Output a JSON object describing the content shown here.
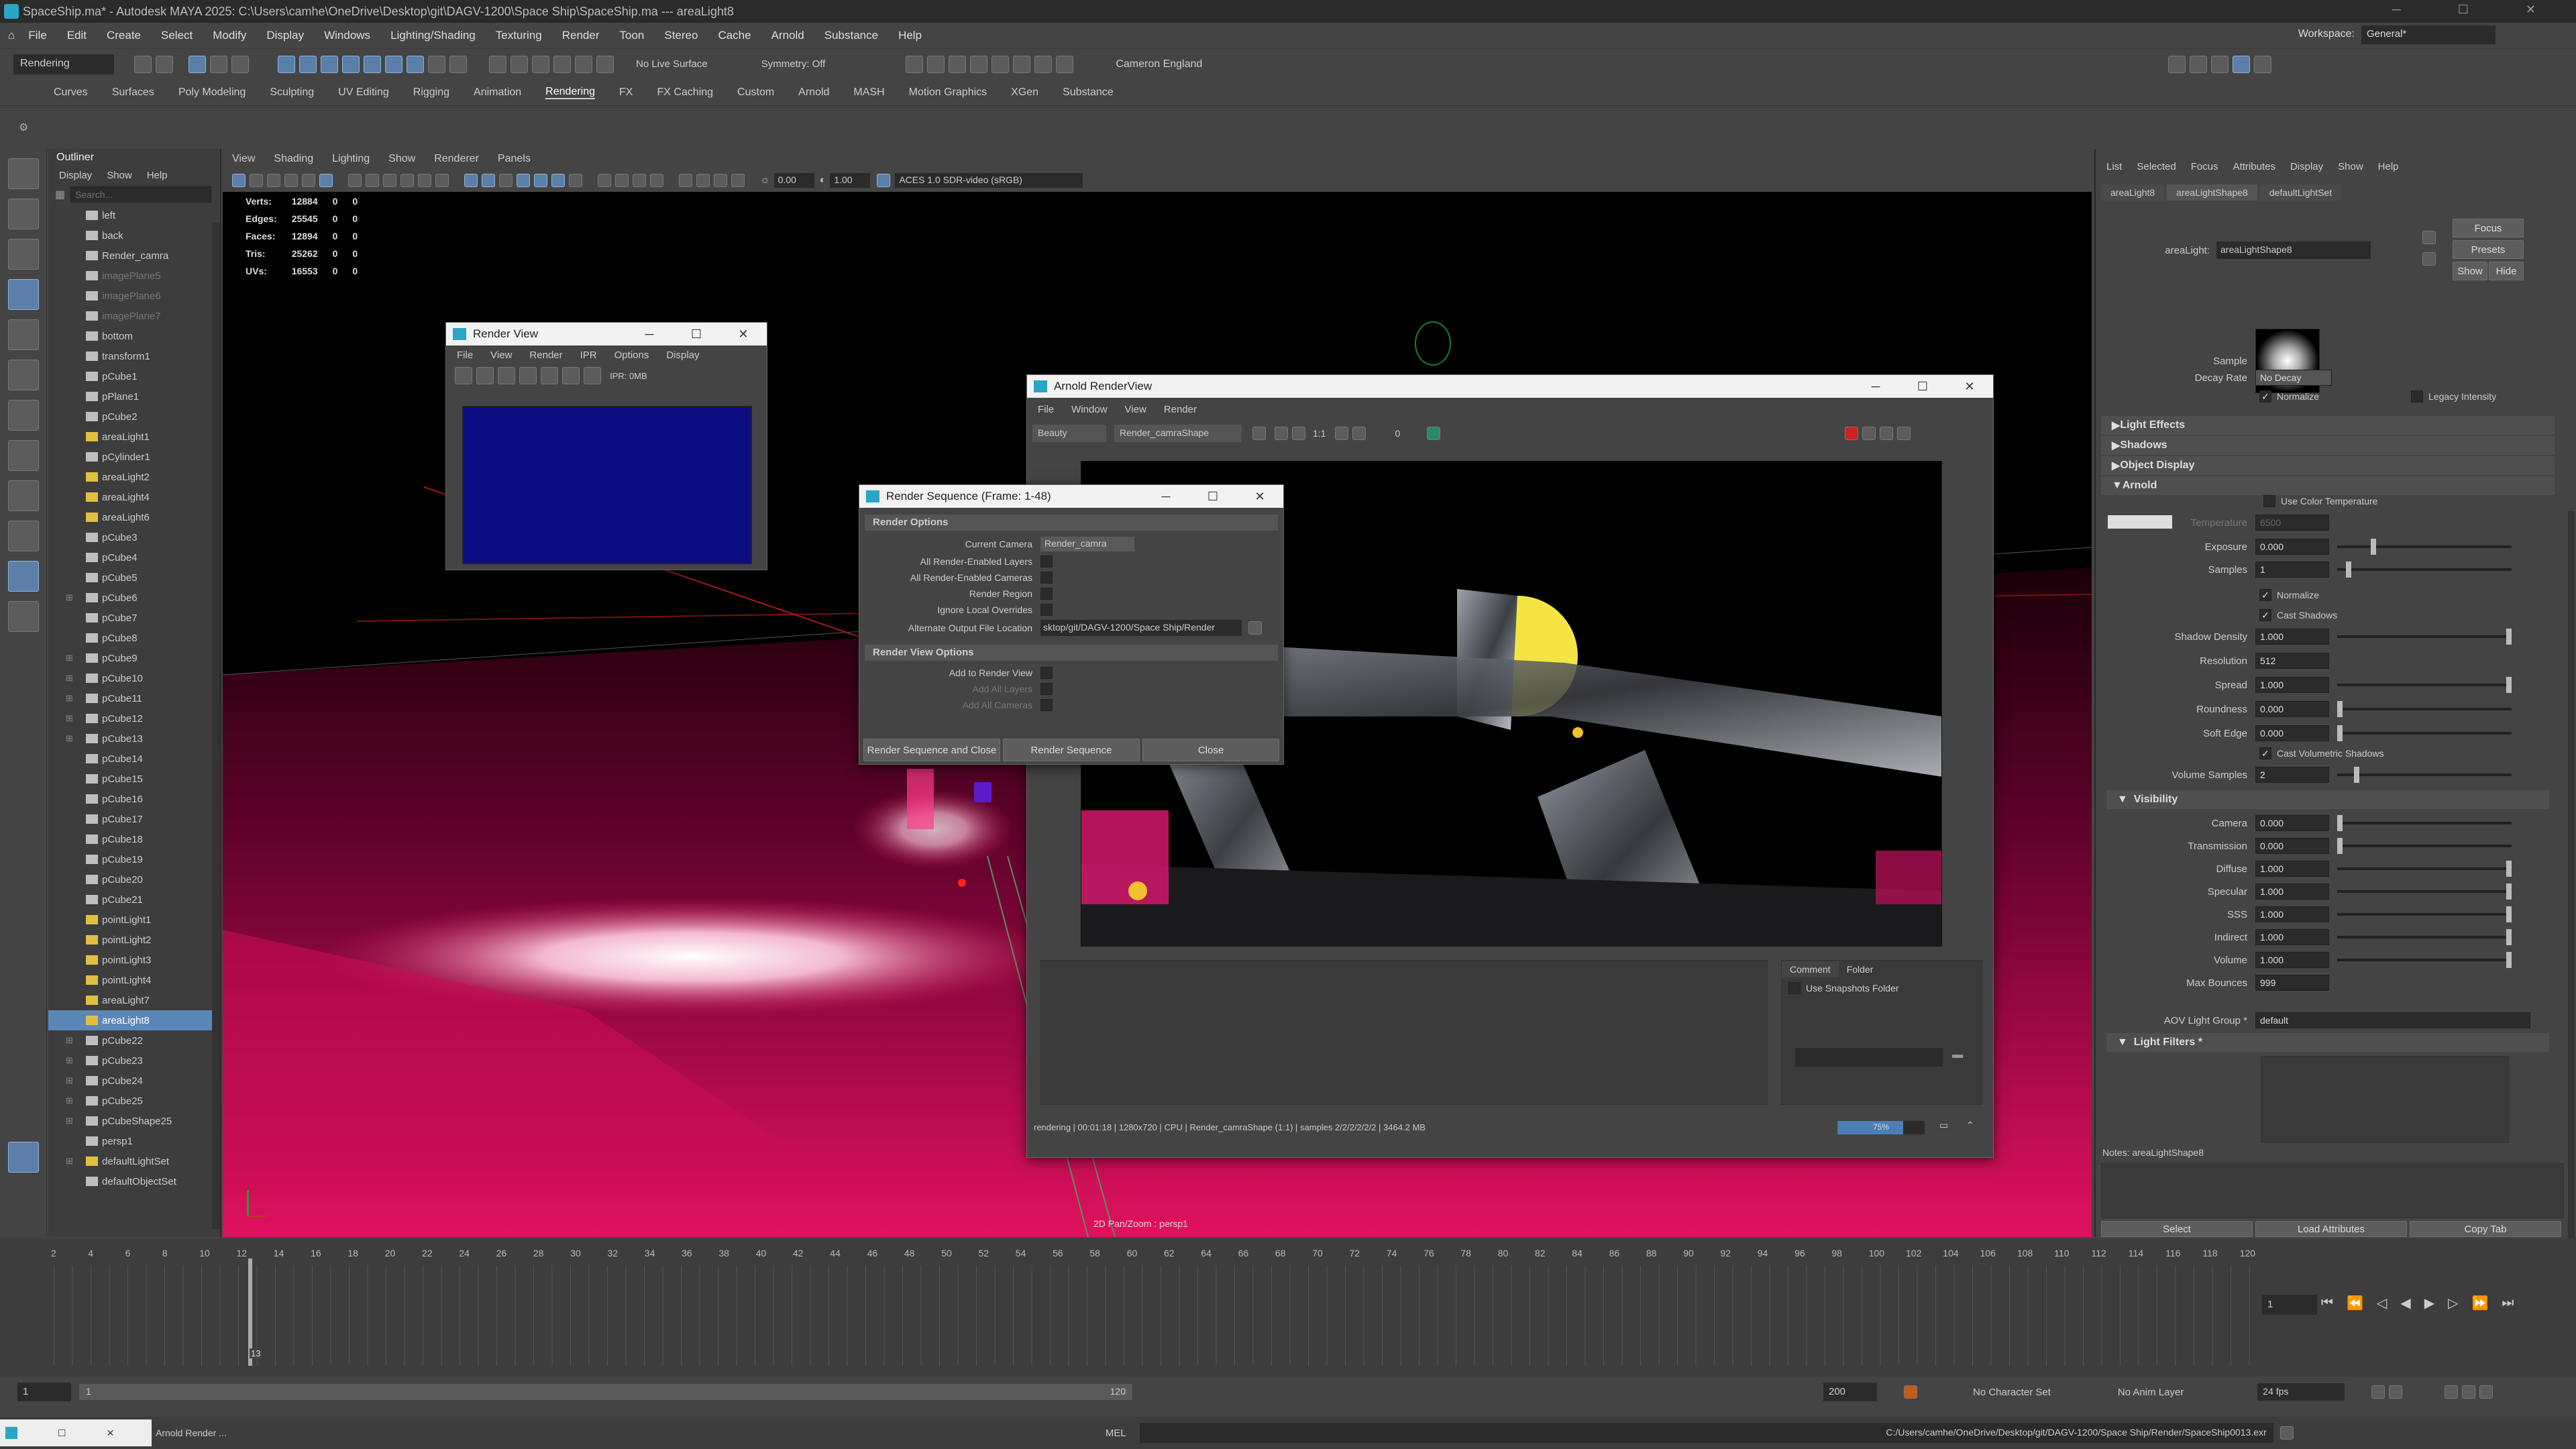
{
  "titlebar": {
    "title": "SpaceShip.ma* - Autodesk MAYA 2025: C:\\Users\\camhe\\OneDrive\\Desktop\\git\\DAGV-1200\\Space Ship\\SpaceShip.ma   ---   areaLight8"
  },
  "menubar": {
    "items": [
      "File",
      "Edit",
      "Create",
      "Select",
      "Modify",
      "Display",
      "Windows",
      "Lighting/Shading",
      "Texturing",
      "Render",
      "Toon",
      "Stereo",
      "Cache",
      "Arnold",
      "Substance",
      "Help"
    ],
    "workspace_label": "Workspace:",
    "workspace_value": "General*"
  },
  "statusline": {
    "menuset": "Rendering",
    "live_surface": "No Live Surface",
    "symmetry": "Symmetry: Off",
    "user": "Cameron England"
  },
  "shelf_tabs": {
    "items": [
      "Curves",
      "Surfaces",
      "Poly Modeling",
      "Sculpting",
      "UV Editing",
      "Rigging",
      "Animation",
      "Rendering",
      "FX",
      "FX Caching",
      "Custom",
      "Arnold",
      "MASH",
      "Motion Graphics",
      "XGen",
      "Substance"
    ],
    "active": "Rendering"
  },
  "outliner": {
    "title": "Outliner",
    "menu": [
      "Display",
      "Show",
      "Help"
    ],
    "search_placeholder": "Search...",
    "items": [
      {
        "label": "left",
        "dim": false
      },
      {
        "label": "back",
        "dim": false
      },
      {
        "label": "Render_camra",
        "dim": false
      },
      {
        "label": "imagePlane5",
        "dim": true
      },
      {
        "label": "imagePlane6",
        "dim": true
      },
      {
        "label": "imagePlane7",
        "dim": true
      },
      {
        "label": "bottom",
        "dim": false
      },
      {
        "label": "transform1",
        "dim": false
      },
      {
        "label": "pCube1",
        "dim": false
      },
      {
        "label": "pPlane1",
        "dim": false
      },
      {
        "label": "pCube2",
        "dim": false
      },
      {
        "label": "areaLight1",
        "dim": false
      },
      {
        "label": "pCylinder1",
        "dim": false
      },
      {
        "label": "areaLight2",
        "dim": false
      },
      {
        "label": "areaLight4",
        "dim": false
      },
      {
        "label": "areaLight6",
        "dim": false
      },
      {
        "label": "pCube3",
        "dim": false
      },
      {
        "label": "pCube4",
        "dim": false
      },
      {
        "label": "pCube5",
        "dim": false
      },
      {
        "label": "pCube6",
        "dim": false
      },
      {
        "label": "pCube7",
        "dim": false
      },
      {
        "label": "pCube8",
        "dim": false
      },
      {
        "label": "pCube9",
        "dim": false
      },
      {
        "label": "pCube10",
        "dim": false
      },
      {
        "label": "pCube11",
        "dim": false
      },
      {
        "label": "pCube12",
        "dim": false
      },
      {
        "label": "pCube13",
        "dim": false
      },
      {
        "label": "pCube14",
        "dim": false
      },
      {
        "label": "pCube15",
        "dim": false
      },
      {
        "label": "pCube16",
        "dim": false
      },
      {
        "label": "pCube17",
        "dim": false
      },
      {
        "label": "pCube18",
        "dim": false
      },
      {
        "label": "pCube19",
        "dim": false
      },
      {
        "label": "pCube20",
        "dim": false
      },
      {
        "label": "pCube21",
        "dim": false
      },
      {
        "label": "pointLight1",
        "dim": false
      },
      {
        "label": "pointLight2",
        "dim": false
      },
      {
        "label": "pointLight3",
        "dim": false
      },
      {
        "label": "pointLight4",
        "dim": false
      },
      {
        "label": "areaLight7",
        "dim": false
      },
      {
        "label": "areaLight8",
        "dim": false,
        "selected": true
      },
      {
        "label": "pCube22",
        "dim": false
      },
      {
        "label": "pCube23",
        "dim": false
      },
      {
        "label": "pCube24",
        "dim": false
      },
      {
        "label": "pCube25",
        "dim": false
      },
      {
        "label": "pCubeShape25",
        "dim": false
      },
      {
        "label": "persp1",
        "dim": false
      },
      {
        "label": "defaultLightSet",
        "dim": false
      },
      {
        "label": "defaultObjectSet",
        "dim": false
      }
    ]
  },
  "viewport": {
    "menu": [
      "View",
      "Shading",
      "Lighting",
      "Show",
      "Renderer",
      "Panels"
    ],
    "exposure": "0.00",
    "gamma": "1.00",
    "color_space": "ACES 1.0 SDR-video (sRGB)",
    "hud": [
      {
        "label": "Verts:",
        "a": "12884",
        "b": "0",
        "c": "0"
      },
      {
        "label": "Edges:",
        "a": "25545",
        "b": "0",
        "c": "0"
      },
      {
        "label": "Faces:",
        "a": "12894",
        "b": "0",
        "c": "0"
      },
      {
        "label": "Tris:",
        "a": "25262",
        "b": "0",
        "c": "0"
      },
      {
        "label": "UVs:",
        "a": "16553",
        "b": "0",
        "c": "0"
      }
    ],
    "status": "2D Pan/Zoom : persp1"
  },
  "render_view": {
    "title": "Render View",
    "menu": [
      "File",
      "View",
      "Render",
      "IPR",
      "Options",
      "Display"
    ],
    "ipr": "IPR: 0MB"
  },
  "render_sequence": {
    "title": "Render Sequence (Frame: 1-48)",
    "section1": "Render Options",
    "current_camera_label": "Current Camera",
    "current_camera_value": "Render_camra",
    "rows": [
      "All Render-Enabled Layers",
      "All Render-Enabled Cameras",
      "Render Region",
      "Ignore Local Overrides"
    ],
    "alt_output_label": "Alternate Output File Location",
    "alt_output_value": "sktop/git/DAGV-1200/Space Ship/Render",
    "section2": "Render View Options",
    "rv_rows": [
      "Add to Render View",
      "Add All Layers",
      "Add All Cameras"
    ],
    "btn_seq_close": "Render Sequence and Close",
    "btn_seq": "Render Sequence",
    "btn_close": "Close"
  },
  "arnold_rv": {
    "title": "Arnold RenderView",
    "menu": [
      "File",
      "Window",
      "View",
      "Render"
    ],
    "aov": "Beauty",
    "camera": "Render_camraShape",
    "ratio": "1:1",
    "exposure": "0",
    "tab_comment": "Comment",
    "tab_folder": "Folder",
    "snapshots": "Use Snapshots Folder",
    "status": "rendering | 00:01:18 | 1280x720 | CPU | Render_camraShape (1:1) | samples 2/2/2/2/2/2 | 3464.2 MB",
    "progress_label": "75%",
    "progress": 0.75
  },
  "attr_editor": {
    "menu": [
      "List",
      "Selected",
      "Focus",
      "Attributes",
      "Display",
      "Show",
      "Help"
    ],
    "tabs": [
      "areaLight8",
      "areaLightShape8",
      "defaultLightSet"
    ],
    "node_label": "areaLight:",
    "node_value": "areaLightShape8",
    "btn_focus": "Focus",
    "btn_presets": "Presets",
    "btn_show": "Show",
    "btn_hide": "Hide",
    "sample_label": "Sample",
    "decay_label": "Decay Rate",
    "decay_value": "No Decay",
    "normalize": "Normalize",
    "legacy": "Legacy Intensity",
    "sections": [
      "Light Effects",
      "Shadows",
      "Object Display",
      "Arnold"
    ],
    "use_color_temp": "Use Color Temperature",
    "temperature_label": "Temperature",
    "temperature_value": "6500",
    "arnold_attrs": [
      {
        "label": "Exposure",
        "value": "0.000",
        "pos": 0.2
      },
      {
        "label": "Samples",
        "value": "1",
        "pos": 0.05
      }
    ],
    "normalize2": "Normalize",
    "cast_shadows": "Cast Shadows",
    "shadow_attrs": [
      {
        "label": "Shadow Density",
        "value": "1.000",
        "pos": 1.0
      },
      {
        "label": "Resolution",
        "value": "512",
        "pos": null
      },
      {
        "label": "Spread",
        "value": "1.000",
        "pos": 1.0
      },
      {
        "label": "Roundness",
        "value": "0.000",
        "pos": 0.0
      },
      {
        "label": "Soft Edge",
        "value": "0.000",
        "pos": 0.0
      }
    ],
    "cast_vol_shadows": "Cast Volumetric Shadows",
    "volume_samples_label": "Volume Samples",
    "volume_samples_value": "2",
    "volume_samples_pos": 0.1,
    "visibility_header": "Visibility",
    "visibility": [
      {
        "label": "Camera",
        "value": "0.000",
        "pos": 0.0
      },
      {
        "label": "Transmission",
        "value": "0.000",
        "pos": 0.0
      },
      {
        "label": "Diffuse",
        "value": "1.000",
        "pos": 1.0
      },
      {
        "label": "Specular",
        "value": "1.000",
        "pos": 1.0
      },
      {
        "label": "SSS",
        "value": "1.000",
        "pos": 1.0
      },
      {
        "label": "Indirect",
        "value": "1.000",
        "pos": 1.0
      },
      {
        "label": "Volume",
        "value": "1.000",
        "pos": 1.0
      },
      {
        "label": "Max Bounces",
        "value": "999",
        "pos": null
      }
    ],
    "aov_label": "AOV Light Group *",
    "aov_value": "default",
    "light_filters": "Light Filters *",
    "notes": "Notes: areaLightShape8",
    "btn_select": "Select",
    "btn_load": "Load Attributes",
    "btn_copy": "Copy Tab"
  },
  "timeline": {
    "ticks": [
      "2",
      "4",
      "6",
      "8",
      "10",
      "12",
      "14",
      "16",
      "18",
      "20",
      "22",
      "24",
      "26",
      "28",
      "30",
      "32",
      "34",
      "36",
      "38",
      "40",
      "42",
      "44",
      "46",
      "48",
      "50",
      "52",
      "54",
      "56",
      "58",
      "60",
      "62",
      "64",
      "66",
      "68",
      "70",
      "72",
      "74",
      "76",
      "78",
      "80",
      "82",
      "84",
      "86",
      "88",
      "90",
      "92",
      "94",
      "96",
      "98",
      "100",
      "102",
      "104",
      "106",
      "108",
      "110",
      "112",
      "114",
      "116",
      "118",
      "120"
    ],
    "current_frame": "13",
    "frame_field": "1"
  },
  "range": {
    "start": "1",
    "inner_start": "1",
    "inner_end": "120",
    "end": "200",
    "character_set": "No Character Set",
    "anim_layer": "No Anim Layer",
    "fps": "24 fps"
  },
  "cmdline": {
    "taskbar_item": "Arnold Render ...",
    "mel": "MEL",
    "result": "C:/Users/camhe/OneDrive/Desktop/git/DAGV-1200/Space Ship/Render/SpaceShip0013.exr"
  }
}
